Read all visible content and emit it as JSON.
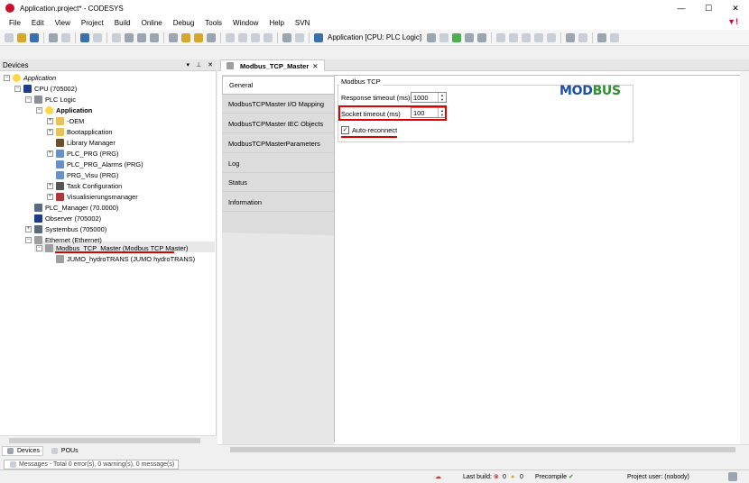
{
  "window": {
    "title": "Application.project* - CODESYS",
    "controls": {
      "minimize": "—",
      "maximize": "☐",
      "close": "✕"
    }
  },
  "menu": {
    "items": [
      "File",
      "Edit",
      "View",
      "Project",
      "Build",
      "Online",
      "Debug",
      "Tools",
      "Window",
      "Help",
      "SVN"
    ]
  },
  "toolbar": {
    "active_application": "Application [CPU: PLC Logic]"
  },
  "devices_panel": {
    "title": "Devices",
    "tree": [
      {
        "id": "application-root",
        "label": "Application",
        "italic": true
      },
      {
        "id": "cpu",
        "label": "CPU (705002)"
      },
      {
        "id": "plc-logic",
        "label": "PLC Logic"
      },
      {
        "id": "application",
        "label": "Application",
        "bold": true
      },
      {
        "id": "oem",
        "label": "-OEM"
      },
      {
        "id": "bootapplication",
        "label": "Bootapplication"
      },
      {
        "id": "library-manager",
        "label": "Library Manager"
      },
      {
        "id": "plc-prg",
        "label": "PLC_PRG (PRG)"
      },
      {
        "id": "plc-prg-alarms",
        "label": "PLC_PRG_Alarms (PRG)"
      },
      {
        "id": "prg-visu",
        "label": "PRG_Visu (PRG)"
      },
      {
        "id": "task-configuration",
        "label": "Task Configuration"
      },
      {
        "id": "visualisierungsmanager",
        "label": "Visualisierungsmanager"
      },
      {
        "id": "plc-manager",
        "label": "PLC_Manager (70.0000)"
      },
      {
        "id": "observer",
        "label": "Observer (705002)"
      },
      {
        "id": "systembus",
        "label": "Systembus (705000)"
      },
      {
        "id": "ethernet",
        "label": "Ethernet (Ethernet)"
      },
      {
        "id": "modbus-master",
        "label": "Modbus_TCP_Master (Modbus TCP Master)"
      },
      {
        "id": "jumo",
        "label": "JUMO_hydroTRANS (JUMO hydroTRANS)"
      }
    ],
    "bottom_tabs": [
      "Devices",
      "POUs"
    ]
  },
  "editor": {
    "tab_title": "Modbus_TCP_Master",
    "side_tabs": [
      "General",
      "ModbusTCPMaster I/O Mapping",
      "ModbusTCPMaster IEC Objects",
      "ModbusTCPMasterParameters",
      "Log",
      "Status",
      "Information"
    ],
    "active_side_tab": "General",
    "group_title": "Modbus TCP",
    "logo_part1": "MOD",
    "logo_part2": "BUS",
    "response_timeout_label": "Response timeout (ms)",
    "response_timeout_value": "1000",
    "socket_timeout_label": "Socket timeout (ms)",
    "socket_timeout_value": "100",
    "auto_reconnect_label": "Auto-reconnect",
    "auto_reconnect_checked": true
  },
  "messages": {
    "text": "Messages - Total 0 error(s), 0 warning(s), 0 message(s)"
  },
  "statusbar": {
    "last_build_label": "Last build:",
    "errors": "0",
    "warnings": "0",
    "precompile_label": "Precompile",
    "project_user": "Project user: (nobody)"
  },
  "colors": {
    "annotation_red": "#e00000",
    "modbus_blue": "#1e4fa6",
    "modbus_green": "#2f8f2f"
  }
}
